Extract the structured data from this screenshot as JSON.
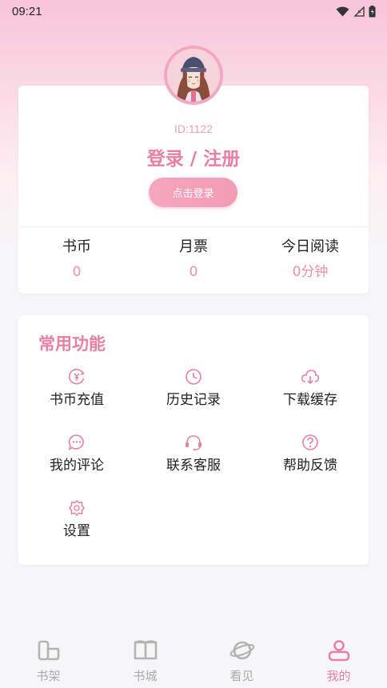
{
  "status_bar": {
    "time": "09:21"
  },
  "profile": {
    "id_text": "ID:1122",
    "login_title": "登录 / 注册",
    "login_button": "点击登录",
    "stats": [
      {
        "label": "书币",
        "value": "0"
      },
      {
        "label": "月票",
        "value": "0"
      },
      {
        "label": "今日阅读",
        "value": "0分钟"
      }
    ]
  },
  "features": {
    "title": "常用功能",
    "items": [
      {
        "label": "书币充值",
        "icon": "coin-icon"
      },
      {
        "label": "历史记录",
        "icon": "clock-icon"
      },
      {
        "label": "下载缓存",
        "icon": "cloud-download-icon"
      },
      {
        "label": "我的评论",
        "icon": "chat-icon"
      },
      {
        "label": "联系客服",
        "icon": "headset-icon"
      },
      {
        "label": "帮助反馈",
        "icon": "help-icon"
      },
      {
        "label": "设置",
        "icon": "settings-icon"
      }
    ]
  },
  "tabbar": {
    "tabs": [
      {
        "label": "书架",
        "icon": "bookshelf-icon",
        "active": false
      },
      {
        "label": "书城",
        "icon": "book-icon",
        "active": false
      },
      {
        "label": "看见",
        "icon": "planet-icon",
        "active": false
      },
      {
        "label": "我的",
        "icon": "profile-icon",
        "active": true
      }
    ]
  },
  "colors": {
    "accent": "#e97fa5",
    "accent_light": "#f29bb6",
    "tab_inactive": "#aaaaaa"
  }
}
